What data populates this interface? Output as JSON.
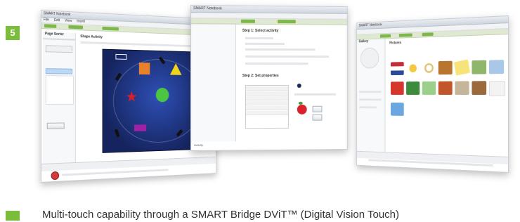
{
  "step": {
    "number": "5"
  },
  "caption": {
    "text": "Multi-touch capability through a SMART Bridge DViT™ (Digital Vision Touch)"
  },
  "left_window": {
    "title": "SMART Notebook",
    "menu": [
      "File",
      "Edit",
      "View",
      "Insert"
    ],
    "panel_title": "Page Sorter",
    "content_title": "Shape Activity"
  },
  "mid_window": {
    "title": "SMART Notebook",
    "sections": [
      "Step 1: Select activity",
      "Step 2: Set properties"
    ],
    "footer_label": "Activity"
  },
  "right_window": {
    "title": "SMART Notebook",
    "panel_title": "Gallery",
    "content_title": "Pictures"
  },
  "colors": {
    "badge": "#79bd3a",
    "canvas": "#1f3a8f",
    "tab_accent": "#7fb84a"
  }
}
